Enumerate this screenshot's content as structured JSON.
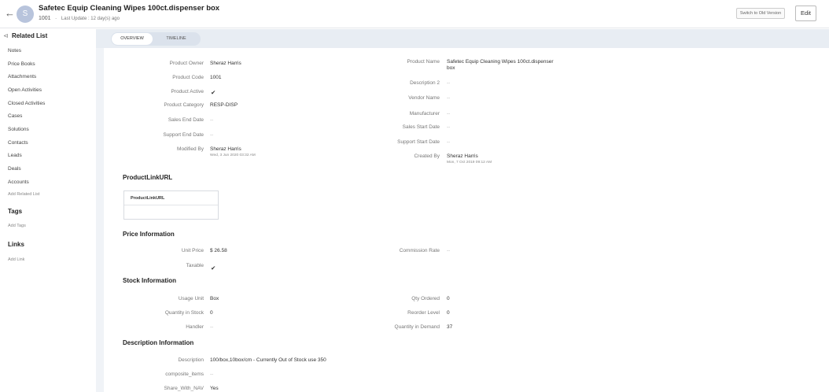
{
  "header": {
    "back_glyph": "←",
    "avatar_letter": "S",
    "title": "Safetec Equip Cleaning Wipes 100ct.dispenser box",
    "code": "1001",
    "separator": "-",
    "last_update": "Last Update : 12 day(s) ago",
    "switch_label": "Switch to Old Version",
    "edit_label": "Edit"
  },
  "sidebar": {
    "related_title": "Related List",
    "collapse_glyph": "⊲",
    "items": [
      "Notes",
      "Price Books",
      "Attachments",
      "Open Activities",
      "Closed Activities",
      "Cases",
      "Solutions",
      "Contacts",
      "Leads",
      "Deals",
      "Accounts"
    ],
    "add_related": "Add Related List",
    "tags_title": "Tags",
    "add_tags": "Add Tags",
    "links_title": "Links",
    "add_link": "Add Link"
  },
  "tabs": {
    "overview": "OVERVIEW",
    "timeline": "TIMELINE"
  },
  "details": {
    "product_owner": {
      "label": "Product Owner",
      "value": "Sheraz Harris"
    },
    "product_code": {
      "label": "Product Code",
      "value": "1001"
    },
    "product_active": {
      "label": "Product Active",
      "value": "✔"
    },
    "product_category": {
      "label": "Product Category",
      "value": "RESP-DISP"
    },
    "sales_end_date": {
      "label": "Sales End Date",
      "value": "--"
    },
    "support_end_date": {
      "label": "Support End Date",
      "value": "--"
    },
    "modified_by": {
      "label": "Modified By",
      "value": "Sheraz Harris",
      "sub": "Wed, 3 Jun 2020 03:32 AM"
    },
    "product_name": {
      "label": "Product Name",
      "value_line1": "Safetec Equip Cleaning Wipes 100ct.dispenser",
      "value_line2": "box"
    },
    "description_2": {
      "label": "Description 2",
      "value": "--"
    },
    "vendor_name": {
      "label": "Vendor Name",
      "value": "--"
    },
    "manufacturer": {
      "label": "Manufacturer",
      "value": "--"
    },
    "sales_start_date": {
      "label": "Sales Start Date",
      "value": "--"
    },
    "support_start_date": {
      "label": "Support Start Date",
      "value": "--"
    },
    "created_by": {
      "label": "Created By",
      "value": "Sheraz Harris",
      "sub": "Mon, 7 Oct 2019 09:12 AM"
    }
  },
  "productlinkurl": {
    "title": "ProductLinkURL",
    "column": "ProductLinkURL"
  },
  "price": {
    "title": "Price Information",
    "unit_price": {
      "label": "Unit Price",
      "value": "$ 26.58"
    },
    "taxable": {
      "label": "Taxable",
      "value": "✔"
    },
    "commission_rate": {
      "label": "Commission Rate",
      "value": "--"
    }
  },
  "stock": {
    "title": "Stock Information",
    "usage_unit": {
      "label": "Usage Unit",
      "value": "Box"
    },
    "quantity_in_stock": {
      "label": "Quantity in Stock",
      "value": "0"
    },
    "handler": {
      "label": "Handler",
      "value": "--"
    },
    "qty_ordered": {
      "label": "Qty Ordered",
      "value": "0"
    },
    "reorder_level": {
      "label": "Reorder Level",
      "value": "0"
    },
    "quantity_in_demand": {
      "label": "Quantity in Demand",
      "value": "37"
    }
  },
  "description": {
    "title": "Description Information",
    "description": {
      "label": "Description",
      "value": "100/box,10box/cm - Currently Out of Stock use 350"
    },
    "composite_items": {
      "label": "composite_items",
      "value": "--"
    },
    "share_with_nav": {
      "label": "Share_With_NAV",
      "value": "Yes"
    }
  }
}
